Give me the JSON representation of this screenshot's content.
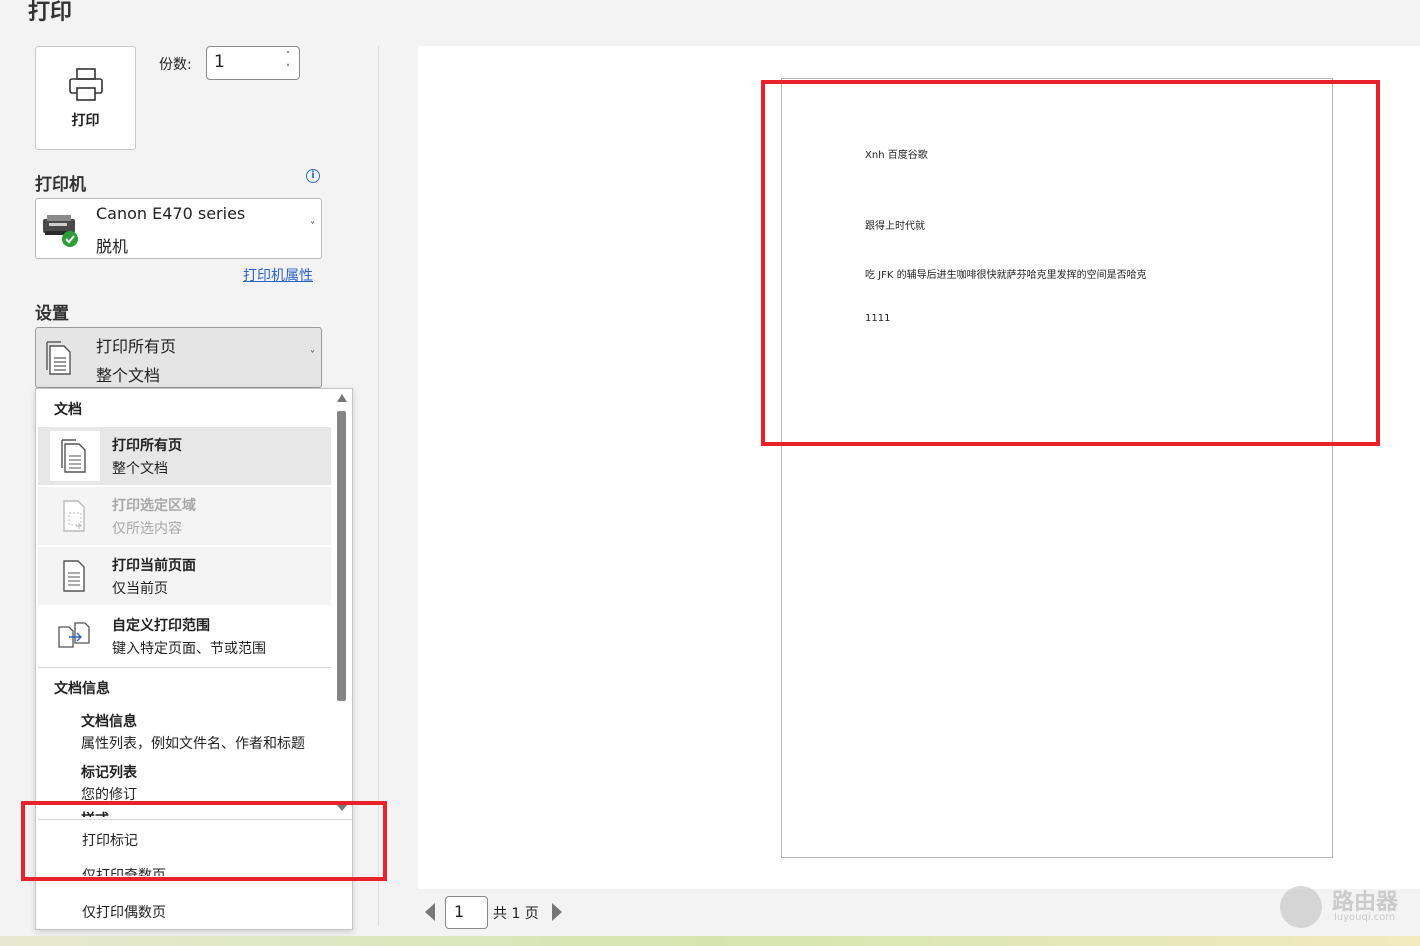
{
  "title": "打印",
  "print_button": {
    "label": "打印",
    "icon": "printer-icon"
  },
  "copies": {
    "label": "份数:",
    "value": "1"
  },
  "printer": {
    "heading": "打印机",
    "name": "Canon E470 series",
    "status": "脱机",
    "properties_link": "打印机属性",
    "icon": "printer-ready-icon"
  },
  "settings": {
    "heading": "设置",
    "selected_line1": "打印所有页",
    "selected_line2": "整个文档"
  },
  "menu": {
    "doc_header": "文档",
    "items": [
      {
        "title": "打印所有页",
        "desc": "整个文档",
        "state": "selected",
        "icon": "all-pages-icon"
      },
      {
        "title": "打印选定区域",
        "desc": "仅所选内容",
        "state": "disabled",
        "icon": "selection-icon"
      },
      {
        "title": "打印当前页面",
        "desc": "仅当前页",
        "state": "normal",
        "icon": "current-page-icon"
      },
      {
        "title": "自定义打印范围",
        "desc": "键入特定页面、节或范围",
        "state": "normal",
        "icon": "custom-range-icon"
      }
    ],
    "info_header": "文档信息",
    "info_items": [
      {
        "title": "文档信息",
        "desc": "属性列表，例如文件名、作者和标题"
      },
      {
        "title": "标记列表",
        "desc": "您的修订"
      }
    ],
    "cut_label": "样式",
    "print_markup": "打印标记",
    "odd_pages": "仅打印奇数页",
    "even_pages": "仅打印偶数页"
  },
  "document_lines": [
    "Xnh 百度谷歌",
    "跟得上时代就",
    "吃 JFK 的辅导后进生咖啡很快就萨芬哈克里发挥的空间是否哈克",
    "1111"
  ],
  "pager": {
    "current": "1",
    "total_label": "共 1 页"
  },
  "watermark": {
    "title": "路由器",
    "sub": "luyouqi.com"
  },
  "colors": {
    "highlight": "#e8212b",
    "link": "#2c63c9"
  }
}
